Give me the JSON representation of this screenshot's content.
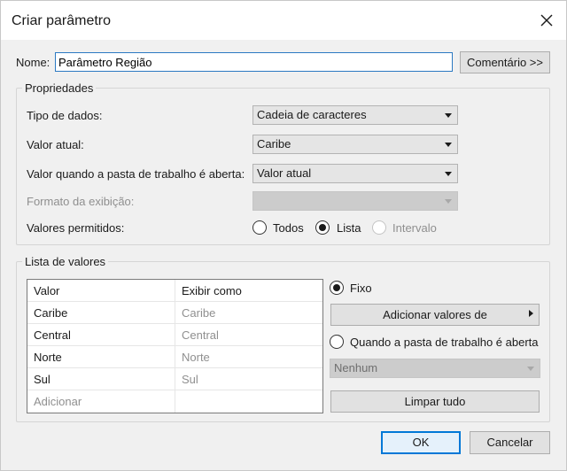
{
  "window": {
    "title": "Criar parâmetro"
  },
  "name": {
    "label": "Nome:",
    "value": "Parâmetro Região",
    "comment_button": "Comentário >>"
  },
  "properties": {
    "group_title": "Propriedades",
    "data_type": {
      "label": "Tipo de dados:",
      "value": "Cadeia de caracteres"
    },
    "current_value": {
      "label": "Valor atual:",
      "value": "Caribe"
    },
    "on_open_value": {
      "label": "Valor quando a pasta de trabalho é aberta:",
      "value": "Valor atual"
    },
    "display_format": {
      "label": "Formato da exibição:",
      "value": ""
    },
    "allowed_values": {
      "label": "Valores permitidos:",
      "options": [
        "Todos",
        "Lista",
        "Intervalo"
      ],
      "selected": "Lista"
    }
  },
  "value_list": {
    "group_title": "Lista de valores",
    "columns": [
      "Valor",
      "Exibir como"
    ],
    "rows": [
      {
        "value": "Caribe",
        "display": "Caribe"
      },
      {
        "value": "Central",
        "display": "Central"
      },
      {
        "value": "Norte",
        "display": "Norte"
      },
      {
        "value": "Sul",
        "display": "Sul"
      }
    ],
    "add_placeholder": "Adicionar",
    "fixed_label": "Fixo",
    "add_values_from": "Adicionar valores de",
    "on_open_label": "Quando a pasta de trabalho é aberta",
    "on_open_select": "Nenhum",
    "clear_all": "Limpar tudo"
  },
  "footer": {
    "ok": "OK",
    "cancel": "Cancelar"
  }
}
